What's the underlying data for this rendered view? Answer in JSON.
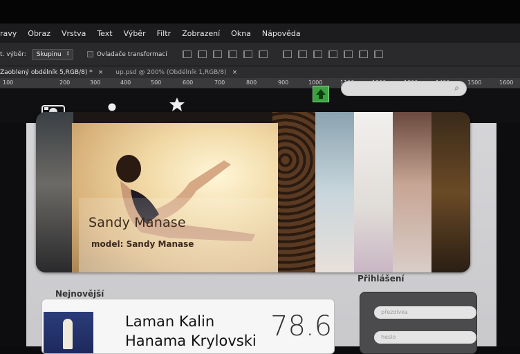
{
  "menu": [
    "ravy",
    "Obraz",
    "Vrstva",
    "Text",
    "Výběr",
    "Filtr",
    "Zobrazení",
    "Okna",
    "Nápověda"
  ],
  "options": {
    "auto_select_label": "t. výběr:",
    "auto_select_value": "Skupinu",
    "transform_controls": "Ovladače transformací"
  },
  "tabs": [
    {
      "label": "Zaoblený obdélník 5,RGB/8) *",
      "close": "×"
    },
    {
      "label": "up.psd @ 200% (Obdélník 1,RGB/8)",
      "close": "×"
    }
  ],
  "ruler": [
    "100",
    "200",
    "300",
    "400",
    "500",
    "600",
    "700",
    "800",
    "900",
    "1000",
    "1100",
    "1200",
    "1300",
    "1400",
    "1500",
    "1600"
  ],
  "hero": {
    "name": "Sandy Manase",
    "model": "model: Sandy Manase"
  },
  "sections": {
    "newest": "Nejnovější",
    "login": "Přihlášení"
  },
  "card": {
    "line1": "Laman Kalin",
    "line2": "Hanama Krylovski",
    "score": "78.6"
  },
  "login": {
    "nickname_placeholder": "přezdívka",
    "password_placeholder": "heslo"
  },
  "colors": {
    "upload": "#3aa23e",
    "chrome": "#1c1c1e"
  }
}
